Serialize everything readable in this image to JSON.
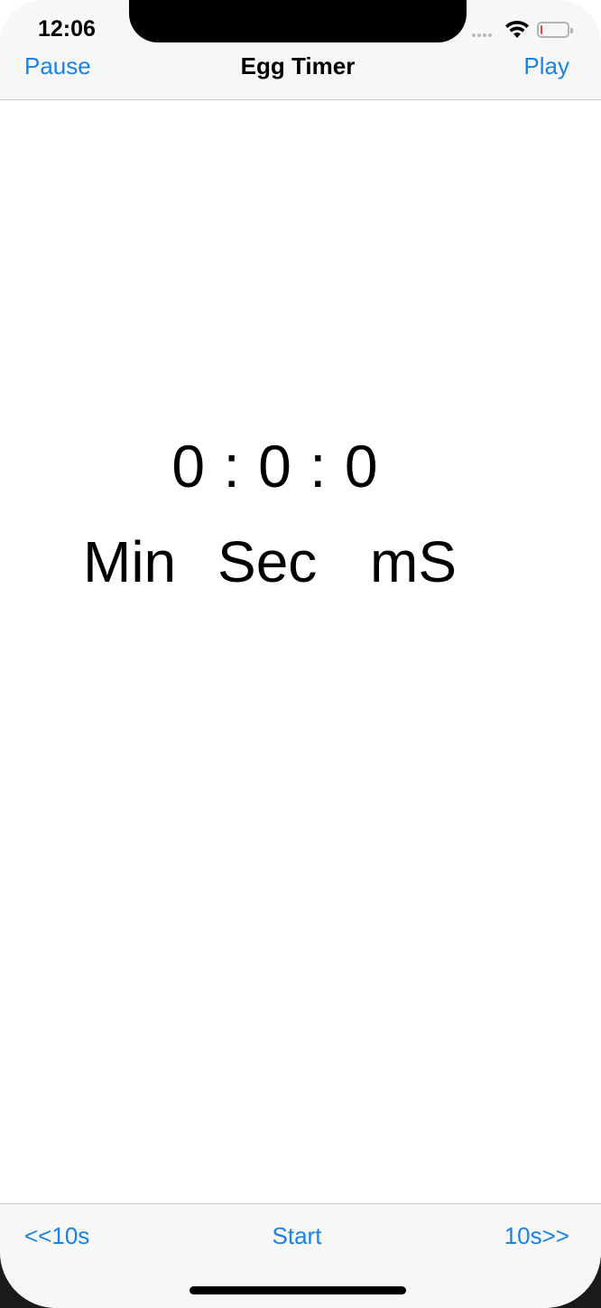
{
  "status_bar": {
    "time": "12:06",
    "icons": [
      "signal-dots-icon",
      "wifi-icon",
      "battery-icon"
    ],
    "battery_level": 0.08,
    "battery_color": "#ff3b30"
  },
  "nav_bar": {
    "left_button": "Pause",
    "title": "Egg Timer",
    "right_button": "Play"
  },
  "timer": {
    "display": "0 : 0 : 0",
    "units": {
      "min": "Min",
      "sec": "Sec",
      "ms": "mS"
    }
  },
  "toolbar": {
    "back_label": "<<10s",
    "start_label": "Start",
    "forward_label": "10s>>"
  },
  "colors": {
    "accent": "#1a82e2",
    "bar_background": "#f7f7f7",
    "separator": "#c8c8cc"
  }
}
